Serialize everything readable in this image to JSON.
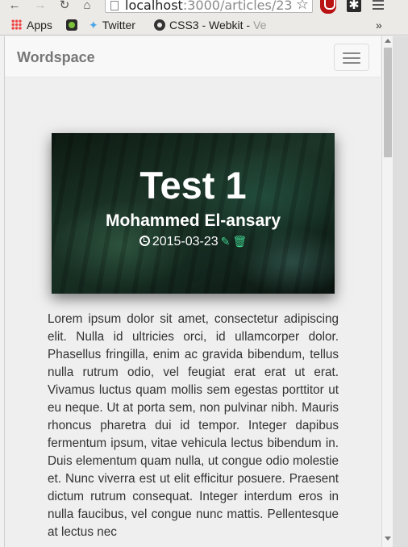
{
  "browser": {
    "url_host": "localhost",
    "url_path": ":3000/articles/23",
    "bookmarks": {
      "apps": "Apps",
      "twitter": "Twitter",
      "css3": "CSS3 - Webkit -",
      "css3_faded": "Ve",
      "more": "»"
    }
  },
  "navbar": {
    "brand": "Wordspace"
  },
  "article": {
    "title": "Test 1",
    "author": "Mohammed El-ansary",
    "date": "2015-03-23",
    "body": "Lorem ipsum dolor sit amet, consectetur adipiscing elit. Nulla id ultricies orci, id ullamcorper dolor. Phasellus fringilla, enim ac gravida bibendum, tellus nulla rutrum odio, vel feugiat erat erat ut erat. Vivamus luctus quam mollis sem egestas porttitor ut eu neque. Ut at porta sem, non pulvinar nibh. Mauris rhoncus pharetra dui id tempor. Integer dapibus fermentum ipsum, vitae vehicula lectus bibendum in. Duis elementum quam nulla, ut congue odio molestie et. Nunc viverra est ut elit efficitur posuere. Praesent dictum rutrum consequat. Integer interdum eros in nulla faucibus, vel congue nunc mattis. Pellentesque at lectus nec"
  },
  "colors": {
    "action_icons": "#3fcf8e",
    "brand_text": "#777777",
    "body_text": "#333333"
  },
  "icons": [
    "back-arrow-icon",
    "forward-arrow-icon",
    "reload-icon",
    "home-icon",
    "star-icon",
    "clock-icon",
    "edit-icon",
    "trash-icon",
    "hamburger-icon"
  ]
}
